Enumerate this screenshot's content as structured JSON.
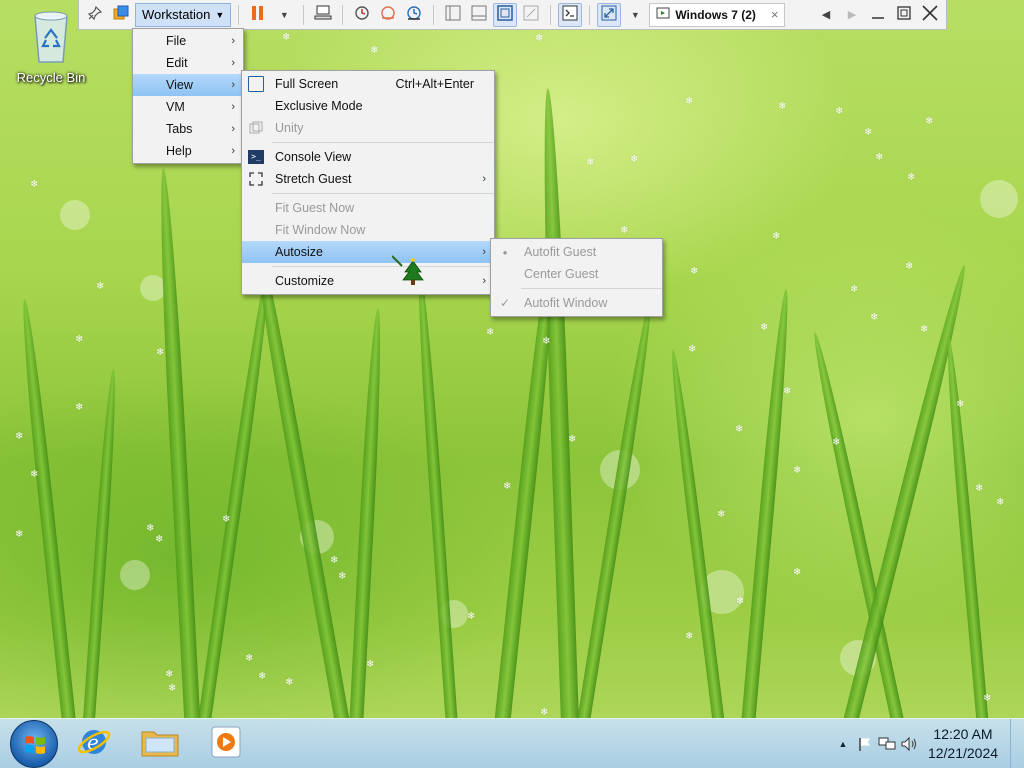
{
  "desktop": {
    "recycle_bin_label": "Recycle Bin"
  },
  "toolbar": {
    "workstation_label": "Workstation",
    "tab_label": "Windows 7 (2)",
    "tab_close": "×"
  },
  "menu_main": {
    "items": [
      {
        "label": "File"
      },
      {
        "label": "Edit"
      },
      {
        "label": "View"
      },
      {
        "label": "VM"
      },
      {
        "label": "Tabs"
      },
      {
        "label": "Help"
      }
    ]
  },
  "menu_view": {
    "full_screen": "Full Screen",
    "full_screen_shortcut": "Ctrl+Alt+Enter",
    "exclusive_mode": "Exclusive Mode",
    "unity": "Unity",
    "console_view": "Console View",
    "stretch_guest": "Stretch Guest",
    "fit_guest_now": "Fit Guest Now",
    "fit_window_now": "Fit Window Now",
    "autosize": "Autosize",
    "customize": "Customize"
  },
  "menu_autosize": {
    "autofit_guest": "Autofit Guest",
    "center_guest": "Center Guest",
    "autofit_window": "Autofit Window"
  },
  "taskbar": {
    "time": "12:20 AM",
    "date": "12/21/2024"
  },
  "colors": {
    "menu_highlight": "#8ec3f3",
    "toolbar_bg": "#f3f3f3",
    "pause_orange": "#f06a1e"
  }
}
